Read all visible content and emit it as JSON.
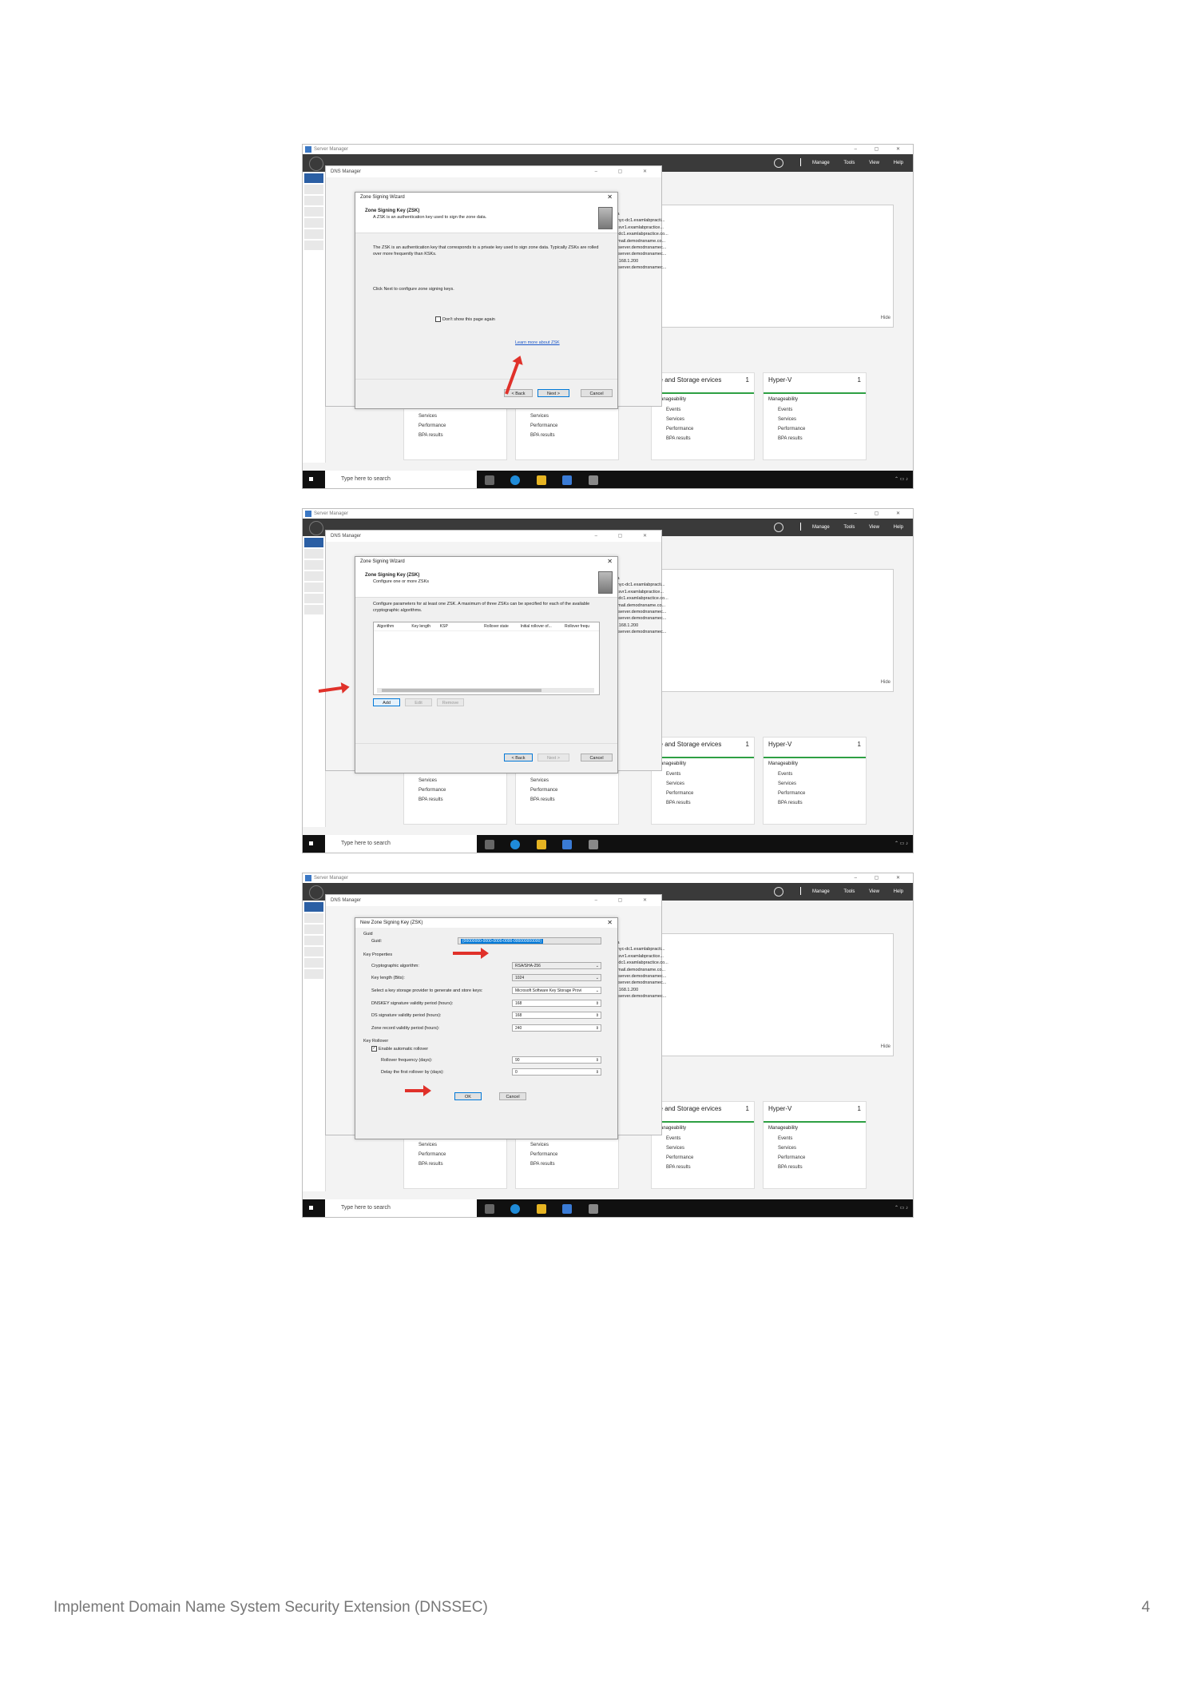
{
  "page": {
    "footer_title": "Implement Domain Name System Security Extension (DNSSEC)",
    "page_number": "4"
  },
  "server_manager": {
    "title": "Server Manager",
    "menu": [
      "Manage",
      "Tools",
      "View",
      "Help"
    ],
    "hide_label": "Hide",
    "background_dialog_title": "DNS Manager",
    "info_header": "Data",
    "info_rows": [
      "11] nyc-dc1.examlabpracti...",
      "nyc-svr1.examlabpractice...",
      "nyc-dc1.examlabpractice.co...",
      "10] mail.demodnsname.co...",
      "webserver.demodnsnamec...",
      "webserver.demodnsnamec...",
      "192.168.1.200",
      "webserver.demodnsnamec..."
    ],
    "tiles": [
      {
        "title": "",
        "count": ""
      },
      {
        "title": "",
        "count": ""
      },
      {
        "title": "ile and Storage ervices",
        "count": "1",
        "status": "Manageability"
      },
      {
        "title": "Hyper-V",
        "count": "1",
        "status": "Manageability"
      }
    ],
    "tile_lines": [
      "Events",
      "Services",
      "Performance",
      "BPA results"
    ],
    "taskbar_search": "Type here to search"
  },
  "step1": {
    "window_title": "Zone Signing Wizard",
    "header_title": "Zone Signing Key (ZSK)",
    "header_subtitle": "A ZSK is an authentication key used to sign the zone data.",
    "body_text": "The ZSK is an authentication key that corresponds to a private key used to sign zone data. Typically ZSKs are rolled over more frequently than KSKs.",
    "instruction": "Click Next to configure zone signing keys.",
    "checkbox_label": "Don't show this page again",
    "learn_more": "Learn more about ZSK",
    "back_label": "< Back",
    "next_label": "Next >",
    "cancel_label": "Cancel"
  },
  "step2": {
    "window_title": "Zone Signing Wizard",
    "header_title": "Zone Signing Key (ZSK)",
    "header_subtitle": "Configure one or more ZSKs",
    "body_text": "Configure parameters for at least one ZSK. A maximum of three ZSKs can be specified for each of the available cryptographic algorithms.",
    "columns": [
      "Algorithm",
      "Key length",
      "KSP",
      "Rollover state",
      "Initial rollover of...",
      "Rollover frequ"
    ],
    "add_label": "Add",
    "edit_label": "Edit",
    "remove_label": "Remove",
    "back_label": "< Back",
    "next_label": "Next >",
    "cancel_label": "Cancel"
  },
  "step3": {
    "window_title": "New Zone Signing Key (ZSK)",
    "guid_group": "Guid",
    "guid_label": "Guid:",
    "guid_value": "{00000000-0000-0000-0000-000000000000}",
    "props_group": "Key Properties",
    "crypto_label": "Cryptographic algorithm:",
    "crypto_value": "RSA/SHA-256",
    "keylen_label": "Key length (Bits):",
    "keylen_value": "1024",
    "ksp_label": "Select a key storage provider to generate and store keys:",
    "ksp_value": "Microsoft Software Key Storage Provi",
    "dnskey_label": "DNSKEY signature validity period (hours):",
    "dnskey_value": "168",
    "ds_label": "DS signature validity period (hours):",
    "ds_value": "168",
    "zone_label": "Zone record validity period (hours):",
    "zone_value": "240",
    "rollover_group": "Key Rollover",
    "enable_label": "Enable automatic rollover",
    "freq_label": "Rollover frequency (days):",
    "freq_value": "90",
    "delay_label": "Delay the first rollover by (days):",
    "delay_value": "0",
    "ok_label": "OK",
    "cancel_label": "Cancel"
  },
  "colors": {
    "taskbar": "#101010",
    "titlebar": "#3a3a3a",
    "accent_green": "#2ea043",
    "arrow_red": "#e0312a",
    "selection_blue": "#0078d7"
  }
}
